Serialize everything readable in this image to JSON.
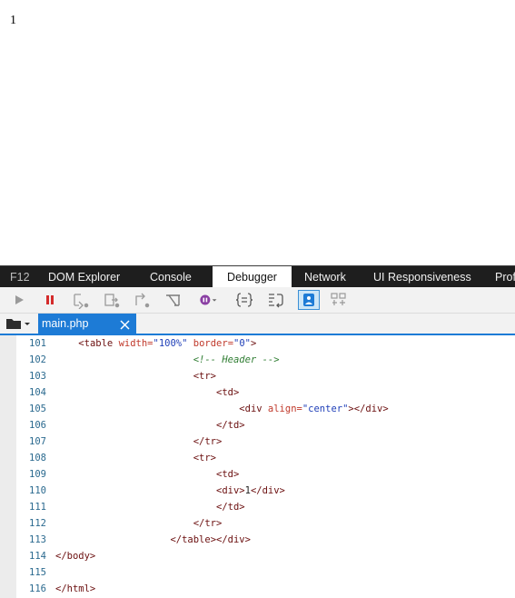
{
  "page": {
    "content_text": "1"
  },
  "devtools": {
    "tabs": [
      {
        "id": "f12",
        "label": "F12"
      },
      {
        "id": "dom",
        "label": "DOM Explorer"
      },
      {
        "id": "console",
        "label": "Console"
      },
      {
        "id": "debugger",
        "label": "Debugger",
        "active": true
      },
      {
        "id": "network",
        "label": "Network"
      },
      {
        "id": "ui",
        "label": "UI Responsiveness"
      },
      {
        "id": "profiler",
        "label": "Prof"
      }
    ],
    "toolbar_icons": [
      "continue-icon",
      "break-icon",
      "step-into-icon",
      "step-over-icon",
      "step-out-icon",
      "break-on-new-worker-icon",
      "exception-behavior-icon",
      "pretty-print-icon",
      "word-wrap-icon",
      "just-my-code-icon",
      "source-maps-icon"
    ],
    "open_file": {
      "name": "main.php",
      "close_glyph": "×"
    },
    "accent": "#1d7bd6"
  },
  "code": [
    {
      "n": "101",
      "indent": "    ",
      "parts": [
        [
          "tag",
          "<table "
        ],
        [
          "attr",
          "width="
        ],
        [
          "str",
          "\"100%\" "
        ],
        [
          "attr",
          "border="
        ],
        [
          "str",
          "\"0\""
        ],
        [
          "tag",
          ">"
        ]
      ]
    },
    {
      "n": "102",
      "indent": "                        ",
      "parts": [
        [
          "comment",
          "<!-- Header -->"
        ]
      ]
    },
    {
      "n": "103",
      "indent": "                        ",
      "parts": [
        [
          "tag",
          "<tr>"
        ]
      ]
    },
    {
      "n": "104",
      "indent": "                            ",
      "parts": [
        [
          "tag",
          "<td>"
        ]
      ]
    },
    {
      "n": "105",
      "indent": "                                ",
      "parts": [
        [
          "tag",
          "<div "
        ],
        [
          "attr",
          "align="
        ],
        [
          "str",
          "\"center\""
        ],
        [
          "tag",
          "></div>"
        ]
      ]
    },
    {
      "n": "106",
      "indent": "                            ",
      "parts": [
        [
          "tag",
          "</td>"
        ]
      ]
    },
    {
      "n": "107",
      "indent": "                        ",
      "parts": [
        [
          "tag",
          "</tr>"
        ]
      ]
    },
    {
      "n": "108",
      "indent": "                        ",
      "parts": [
        [
          "tag",
          "<tr>"
        ]
      ]
    },
    {
      "n": "109",
      "indent": "                            ",
      "parts": [
        [
          "tag",
          "<td>"
        ]
      ]
    },
    {
      "n": "110",
      "indent": "                            ",
      "parts": [
        [
          "tag",
          "<div>"
        ],
        [
          "txt",
          "1"
        ],
        [
          "tag",
          "</div>"
        ]
      ]
    },
    {
      "n": "111",
      "indent": "                            ",
      "parts": [
        [
          "tag",
          "</td>"
        ]
      ]
    },
    {
      "n": "112",
      "indent": "                        ",
      "parts": [
        [
          "tag",
          "</tr>"
        ]
      ]
    },
    {
      "n": "113",
      "indent": "                    ",
      "parts": [
        [
          "tag",
          "</table></div>"
        ]
      ]
    },
    {
      "n": "114",
      "indent": "",
      "parts": [
        [
          "tag",
          "</body>"
        ]
      ]
    },
    {
      "n": "115",
      "indent": "",
      "parts": []
    },
    {
      "n": "116",
      "indent": "",
      "parts": [
        [
          "tag",
          "</html>"
        ]
      ]
    }
  ]
}
